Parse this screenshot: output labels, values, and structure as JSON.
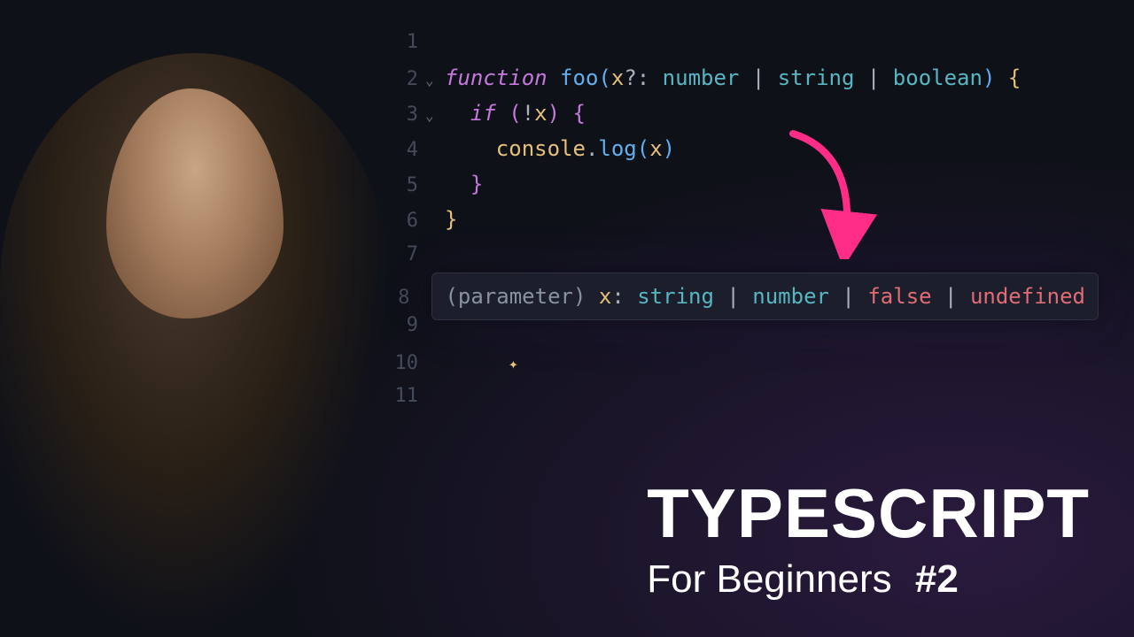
{
  "editor": {
    "lines": [
      {
        "n": "1",
        "fold": "",
        "tokens": []
      },
      {
        "n": "2",
        "fold": "⌄",
        "tokens": [
          {
            "c": "kw",
            "t": "function "
          },
          {
            "c": "fn",
            "t": "foo"
          },
          {
            "c": "brace-b",
            "t": "("
          },
          {
            "c": "ident",
            "t": "x"
          },
          {
            "c": "punct",
            "t": "?"
          },
          {
            "c": "punct",
            "t": ": "
          },
          {
            "c": "type",
            "t": "number"
          },
          {
            "c": "op",
            "t": " | "
          },
          {
            "c": "type",
            "t": "string"
          },
          {
            "c": "op",
            "t": " | "
          },
          {
            "c": "type",
            "t": "boolean"
          },
          {
            "c": "brace-b",
            "t": ") "
          },
          {
            "c": "brace-y",
            "t": "{"
          }
        ]
      },
      {
        "n": "3",
        "fold": "⌄",
        "tokens": [
          {
            "c": "code",
            "t": "  "
          },
          {
            "c": "kw",
            "t": "if "
          },
          {
            "c": "brace-p",
            "t": "("
          },
          {
            "c": "op",
            "t": "!"
          },
          {
            "c": "ident",
            "t": "x"
          },
          {
            "c": "brace-p",
            "t": ") "
          },
          {
            "c": "brace-p",
            "t": "{"
          }
        ]
      },
      {
        "n": "4",
        "fold": "",
        "tokens": [
          {
            "c": "code",
            "t": "    "
          },
          {
            "c": "ident",
            "t": "console"
          },
          {
            "c": "punct",
            "t": "."
          },
          {
            "c": "fn",
            "t": "log"
          },
          {
            "c": "brace-b",
            "t": "("
          },
          {
            "c": "ident",
            "t": "x"
          },
          {
            "c": "brace-b",
            "t": ")"
          }
        ]
      },
      {
        "n": "5",
        "fold": "",
        "tokens": [
          {
            "c": "code",
            "t": "  "
          },
          {
            "c": "brace-p",
            "t": "}"
          }
        ]
      },
      {
        "n": "6",
        "fold": "",
        "tokens": [
          {
            "c": "brace-y",
            "t": "}"
          }
        ]
      },
      {
        "n": "7",
        "fold": "",
        "tokens": []
      },
      {
        "n": "8",
        "fold": "",
        "tooltip": true
      },
      {
        "n": "9",
        "fold": "",
        "tokens": []
      },
      {
        "n": "10",
        "fold": "",
        "sparkle": true
      },
      {
        "n": "11",
        "fold": "",
        "tokens": []
      }
    ]
  },
  "tooltip": {
    "label_parameter": "(parameter)",
    "ident": "x",
    "colon": ":",
    "types": [
      {
        "c": "tt-str",
        "t": "string"
      },
      {
        "c": "tt-str",
        "t": "number"
      },
      {
        "c": "tt-false",
        "t": "false"
      },
      {
        "c": "tt-undef",
        "t": "undefined"
      }
    ],
    "sep": " | "
  },
  "sparkle_glyph": "✦",
  "title": {
    "main": "TYPESCRIPT",
    "sub": "For Beginners",
    "num": "#2"
  }
}
